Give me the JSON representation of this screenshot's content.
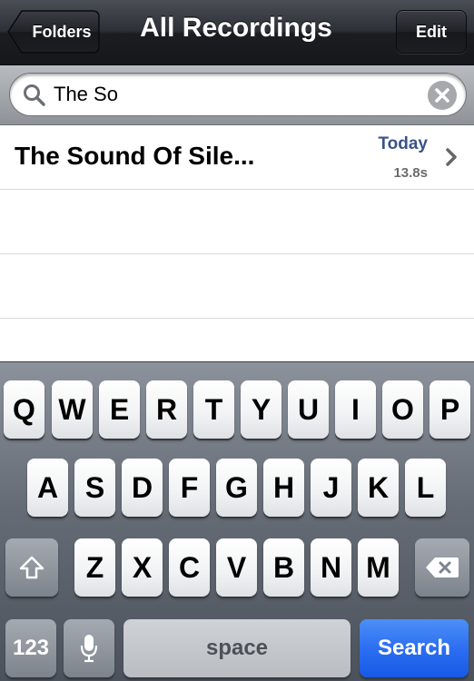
{
  "navbar": {
    "title": "All Recordings",
    "back_label": "Folders",
    "edit_label": "Edit"
  },
  "search": {
    "value": "The So"
  },
  "recordings": [
    {
      "title": "The Sound Of Sile...",
      "date": "Today",
      "duration": "13.8s"
    }
  ],
  "keyboard": {
    "row1": [
      "Q",
      "W",
      "E",
      "R",
      "T",
      "Y",
      "U",
      "I",
      "O",
      "P"
    ],
    "row2": [
      "A",
      "S",
      "D",
      "F",
      "G",
      "H",
      "J",
      "K",
      "L"
    ],
    "row3": [
      "Z",
      "X",
      "C",
      "V",
      "B",
      "N",
      "M"
    ],
    "numbers_label": "123",
    "space_label": "space",
    "search_label": "Search"
  }
}
